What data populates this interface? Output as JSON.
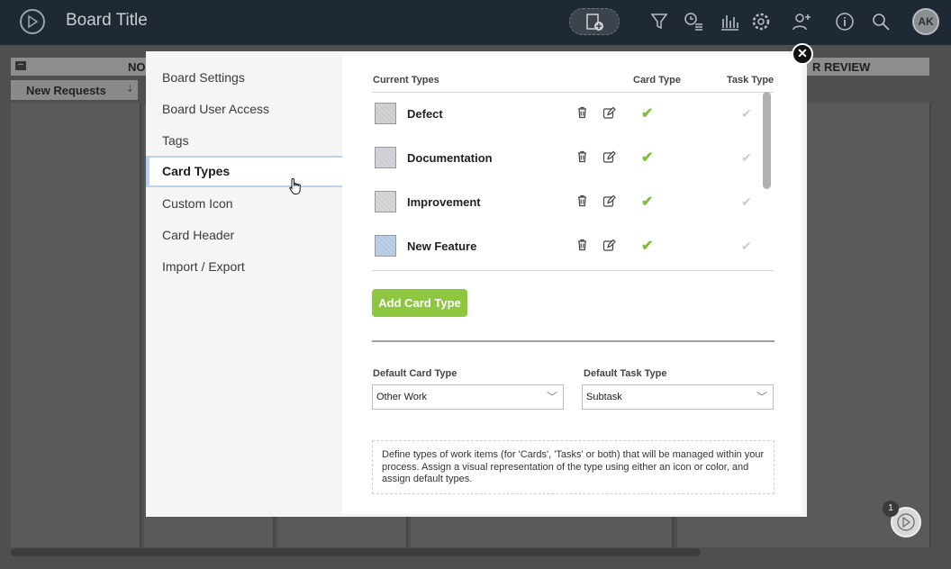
{
  "topbar": {
    "board_title": "Board Title",
    "avatar_initials": "AK",
    "icons": [
      "board-logo-icon",
      "new-card-icon",
      "filter-icon",
      "timer-list-icon",
      "analytics-icon",
      "gear-icon",
      "add-user-icon",
      "info-icon",
      "search-icon"
    ]
  },
  "board": {
    "lane_headers": [
      "NO",
      "R REVIEW"
    ],
    "sublane": "New Requests"
  },
  "modal": {
    "nav": [
      {
        "label": "Board Settings",
        "active": false
      },
      {
        "label": "Board User Access",
        "active": false
      },
      {
        "label": "Tags",
        "active": false
      },
      {
        "label": "Card Types",
        "active": true
      },
      {
        "label": "Custom Icon",
        "active": false
      },
      {
        "label": "Card Header",
        "active": false
      },
      {
        "label": "Import / Export",
        "active": false
      }
    ],
    "columns": {
      "current_types": "Current Types",
      "card_type": "Card Type",
      "task_type": "Task Type"
    },
    "types": [
      {
        "name": "Defect",
        "color": "#d3d3d3",
        "card_type": true,
        "task_type": false
      },
      {
        "name": "Documentation",
        "color": "#d3d5da",
        "card_type": true,
        "task_type": false
      },
      {
        "name": "Improvement",
        "color": "#d7d7d7",
        "card_type": true,
        "task_type": false
      },
      {
        "name": "New Feature",
        "color": "#bcd0ea",
        "card_type": true,
        "task_type": false
      }
    ],
    "add_button": "Add Card Type",
    "default_card_label": "Default Card Type",
    "default_card_value": "Other Work",
    "default_task_label": "Default Task Type",
    "default_task_value": "Subtask",
    "description": "Define types of work items (for 'Cards', 'Tasks' or both) that will be managed within your process. Assign a visual representation of the type using either an icon or color, and assign default types."
  },
  "help": {
    "badge": "1"
  },
  "colors": {
    "accent_green": "#8dc63f",
    "active_border": "#b7d3ef",
    "topbar": "#1f2933"
  }
}
